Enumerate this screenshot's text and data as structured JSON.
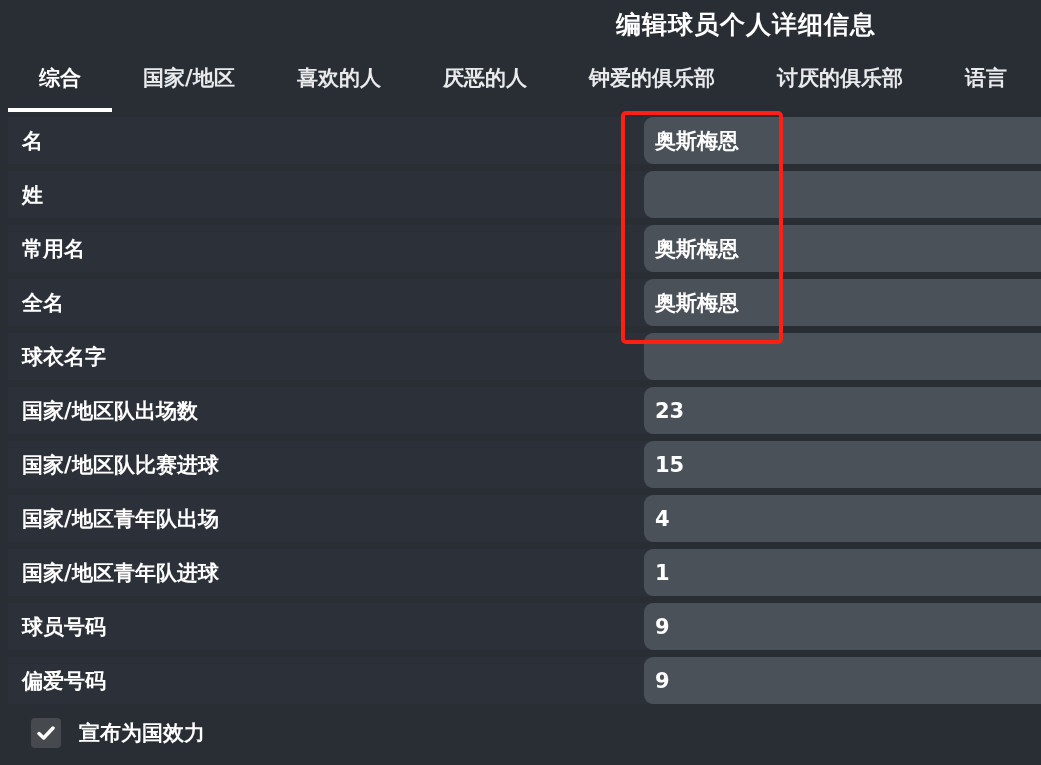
{
  "title": "编辑球员个人详细信息",
  "tabs": [
    {
      "label": "综合",
      "selected": true
    },
    {
      "label": "国家/地区",
      "selected": false
    },
    {
      "label": "喜欢的人",
      "selected": false
    },
    {
      "label": "厌恶的人",
      "selected": false
    },
    {
      "label": "钟爱的俱乐部",
      "selected": false
    },
    {
      "label": "讨厌的俱乐部",
      "selected": false
    },
    {
      "label": "语言",
      "selected": false
    }
  ],
  "rows": [
    {
      "label": "名",
      "value": "奥斯梅恩",
      "highlighted": true
    },
    {
      "label": "姓",
      "highlighted": true
    },
    {
      "label": "常用名",
      "value": "奥斯梅恩",
      "highlighted": true
    },
    {
      "label": "全名",
      "value": "奥斯梅恩",
      "highlighted": true
    },
    {
      "label": "球衣名字",
      "highlighted": false
    },
    {
      "label": "国家/地区队出场数",
      "value": "23",
      "highlighted": false
    },
    {
      "label": "国家/地区队比赛进球",
      "value": "15",
      "highlighted": false
    },
    {
      "label": "国家/地区青年队出场",
      "value": "4",
      "highlighted": false
    },
    {
      "label": "国家/地区青年队进球",
      "value": "1",
      "highlighted": false
    },
    {
      "label": "球员号码",
      "value": "9",
      "highlighted": false
    },
    {
      "label": "偏爱号码",
      "value": "9",
      "highlighted": false
    }
  ],
  "declare_for_country": {
    "label": "宣布为国效力",
    "checked": true
  }
}
